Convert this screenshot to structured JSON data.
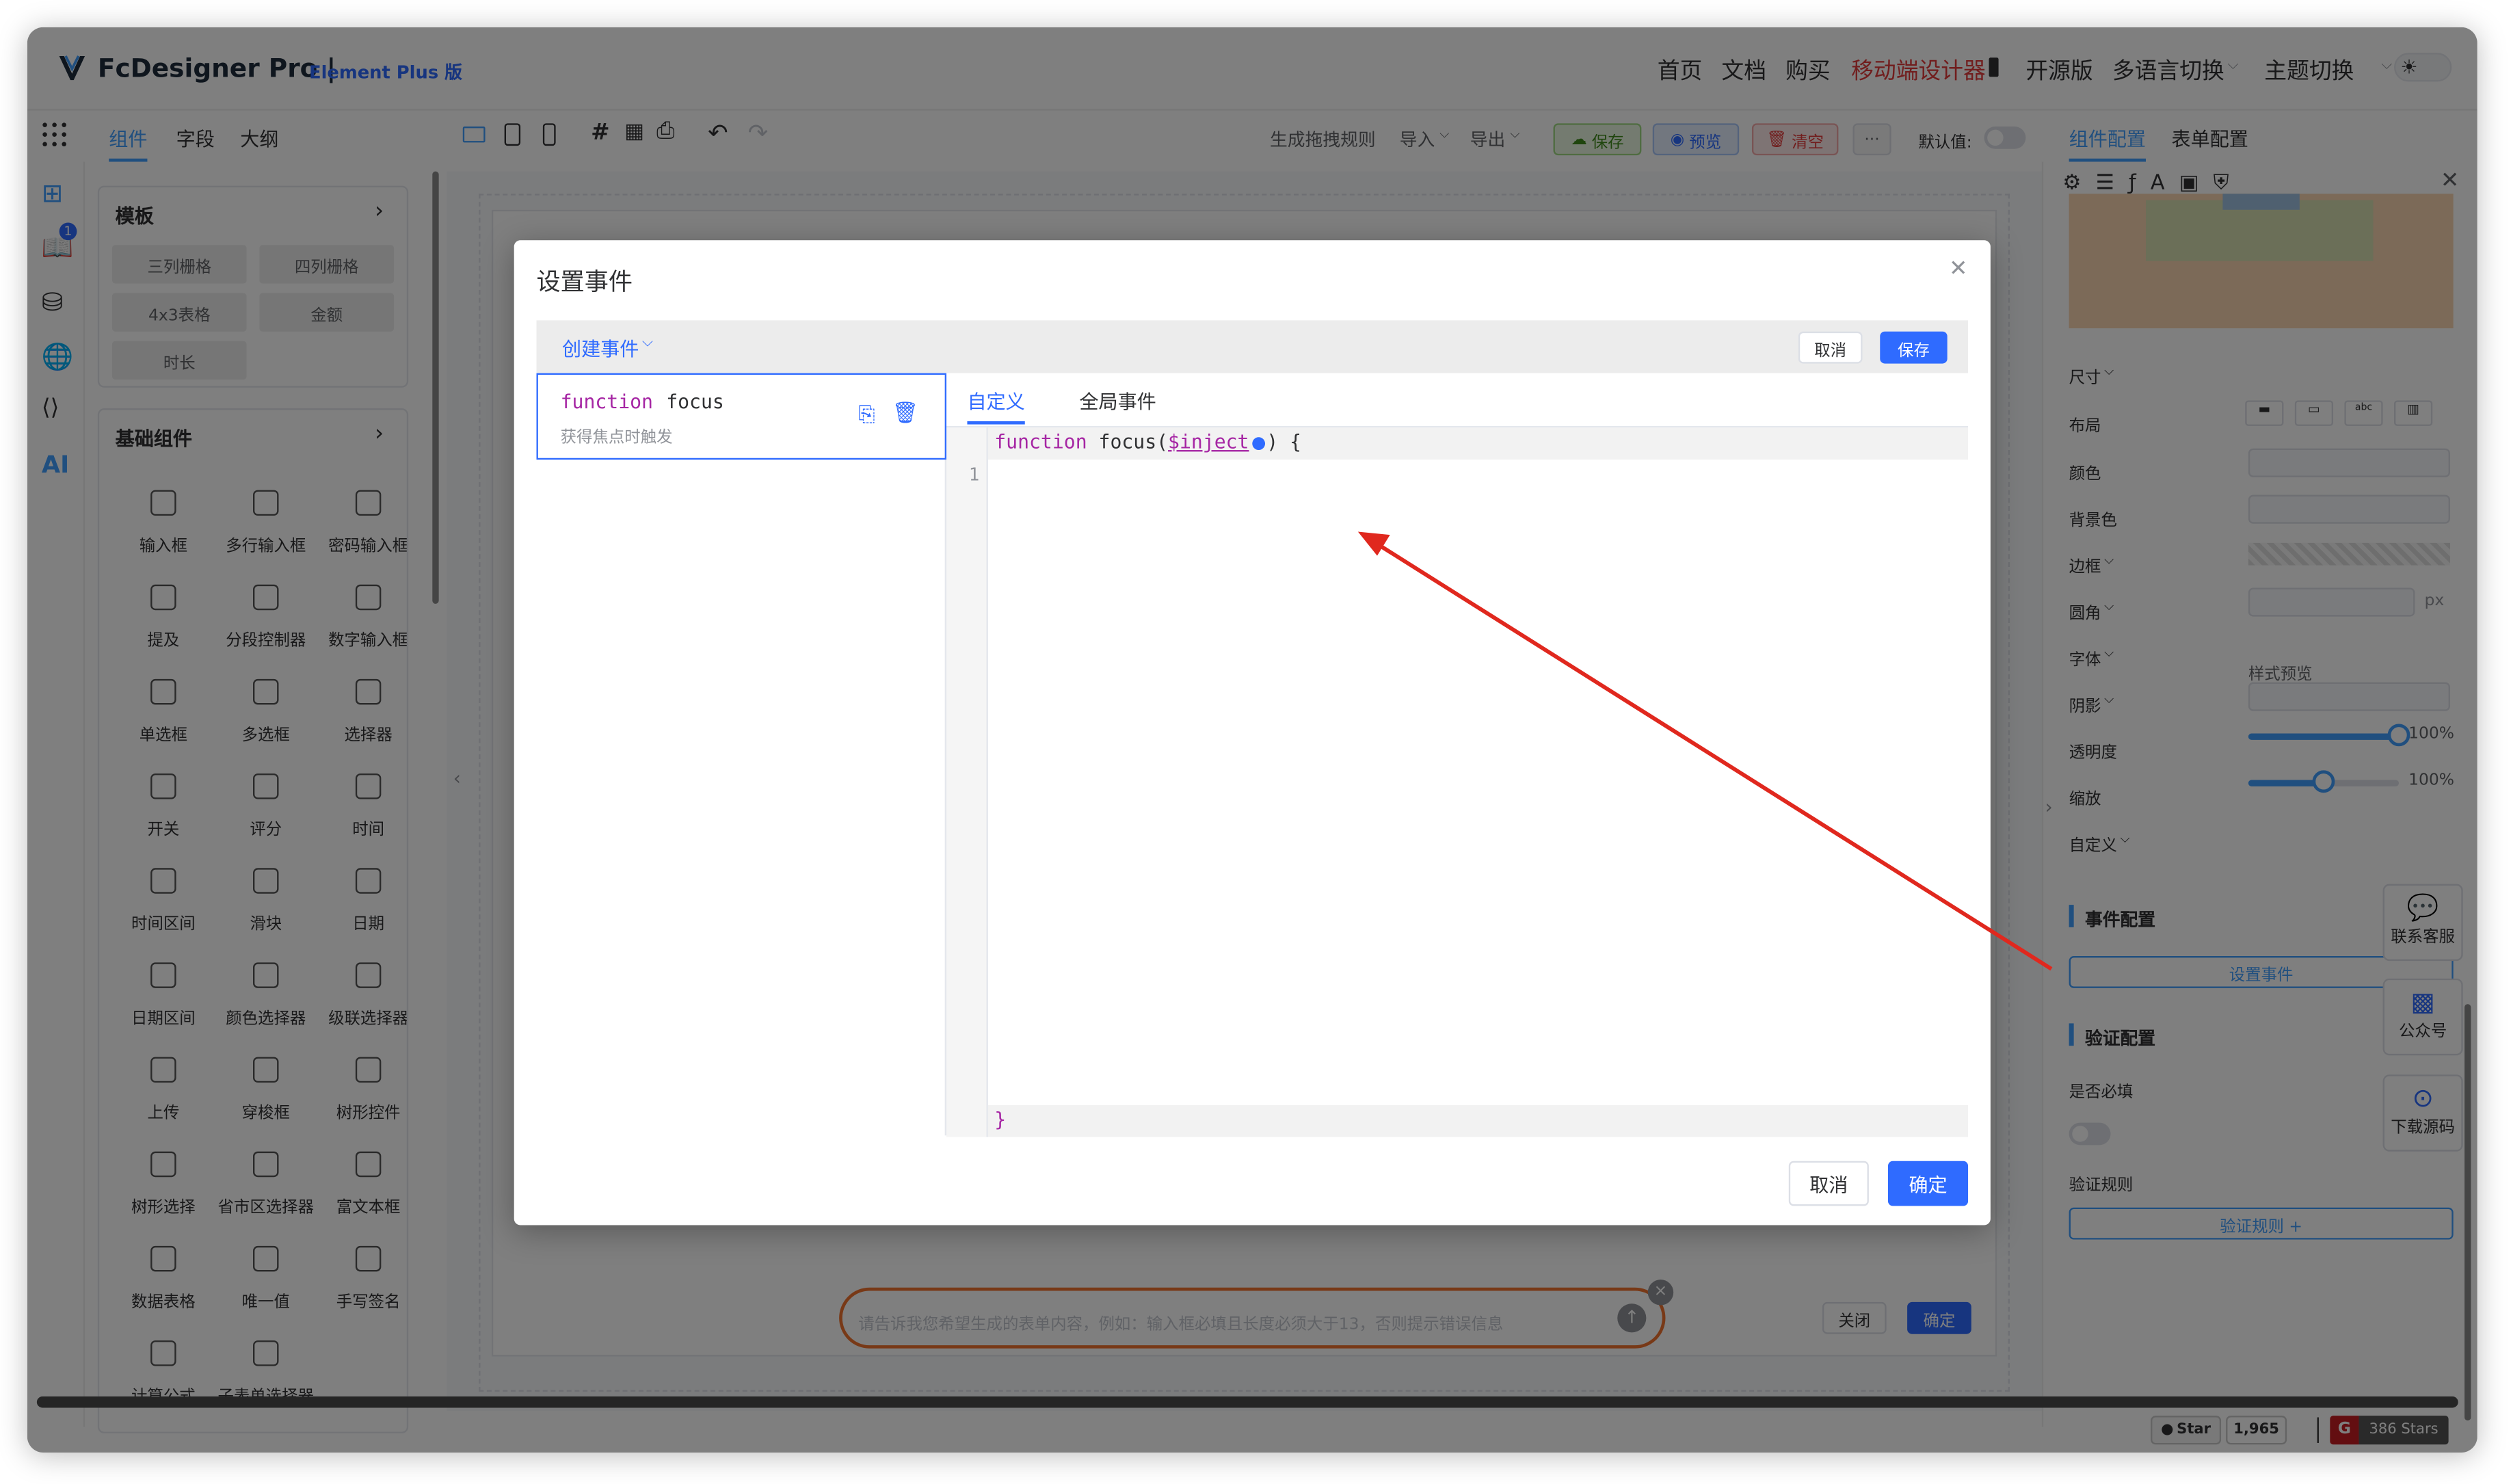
{
  "header": {
    "brand": "FcDesigner Pro |",
    "brand_sub": "Element Plus 版",
    "nav": [
      "首页",
      "文档",
      "购买",
      "移动端设计器",
      "开源版",
      "多语言切换",
      "主题切换"
    ]
  },
  "toolbar": {
    "tabs": [
      "组件",
      "字段",
      "大纲"
    ],
    "actions": [
      "生成拖拽规则",
      "导入",
      "导出"
    ],
    "save": "保存",
    "preview": "预览",
    "clear": "清空",
    "more": "···",
    "default_label": "默认值:"
  },
  "left_panel": {
    "templates_title": "模板",
    "templates": [
      "三列栅格",
      "四列栅格",
      "4x3表格",
      "金额",
      "时长"
    ],
    "basic_title": "基础组件",
    "components": [
      "输入框",
      "多行输入框",
      "密码输入框",
      "提及",
      "分段控制器",
      "数字输入框",
      "单选框",
      "多选框",
      "选择器",
      "开关",
      "评分",
      "时间",
      "时间区间",
      "滑块",
      "日期",
      "日期区间",
      "颜色选择器",
      "级联选择器",
      "上传",
      "穿梭框",
      "树形控件",
      "树形选择",
      "省市区选择器",
      "富文本框",
      "数据表格",
      "唯一值",
      "手写签名",
      "计算公式",
      "子表单选择器"
    ],
    "side_badge": "1",
    "ai_label": "AI"
  },
  "right_panel": {
    "tabs": [
      "组件配置",
      "表单配置"
    ],
    "rows": [
      "尺寸",
      "布局",
      "颜色",
      "背景色",
      "边框",
      "圆角",
      "字体",
      "阴影",
      "透明度",
      "缩放",
      "自定义"
    ],
    "font_preview": "样式预览",
    "unit": "px",
    "opacity_value": "100%",
    "scale_value": "100%",
    "opacity_level": 1.0,
    "scale_level": 0.5,
    "event_section": "事件配置",
    "event_button": "设置事件",
    "validate_section": "验证配置",
    "required_label": "是否必填",
    "rules_label": "验证规则",
    "rules_button": "验证规则 +"
  },
  "floating": {
    "support": "联系客服",
    "wechat": "公众号",
    "download": "下载源码"
  },
  "canvas": {
    "ai_placeholder": "请告诉我您希望生成的表单内容，例如：输入框必填且长度必须大于13，否则提示错误信息",
    "close": "关闭",
    "confirm": "确定"
  },
  "footer": {
    "star": "Star",
    "star_count": "1,965",
    "gitee_stars": "386 Stars",
    "gitee_badge": "G"
  },
  "modal": {
    "title": "设置事件",
    "create_event": "创建事件",
    "cancel_small": "取消",
    "save_small": "保存",
    "event_keyword": "function",
    "event_name": "focus",
    "event_desc": "获得焦点时触发",
    "tabs": [
      "自定义",
      "全局事件"
    ],
    "code_line1_kw": "function",
    "code_line1_name": " focus(",
    "code_line1_param": "$inject",
    "code_line1_end": ") {",
    "line_number": "1",
    "code_close": "}",
    "cancel": "取消",
    "confirm": "确定"
  },
  "colors": {
    "primary": "#409eff",
    "accent": "#2f6bff",
    "danger": "#e23b3b",
    "success": "#67c23a",
    "annotation": "#e0281e"
  }
}
